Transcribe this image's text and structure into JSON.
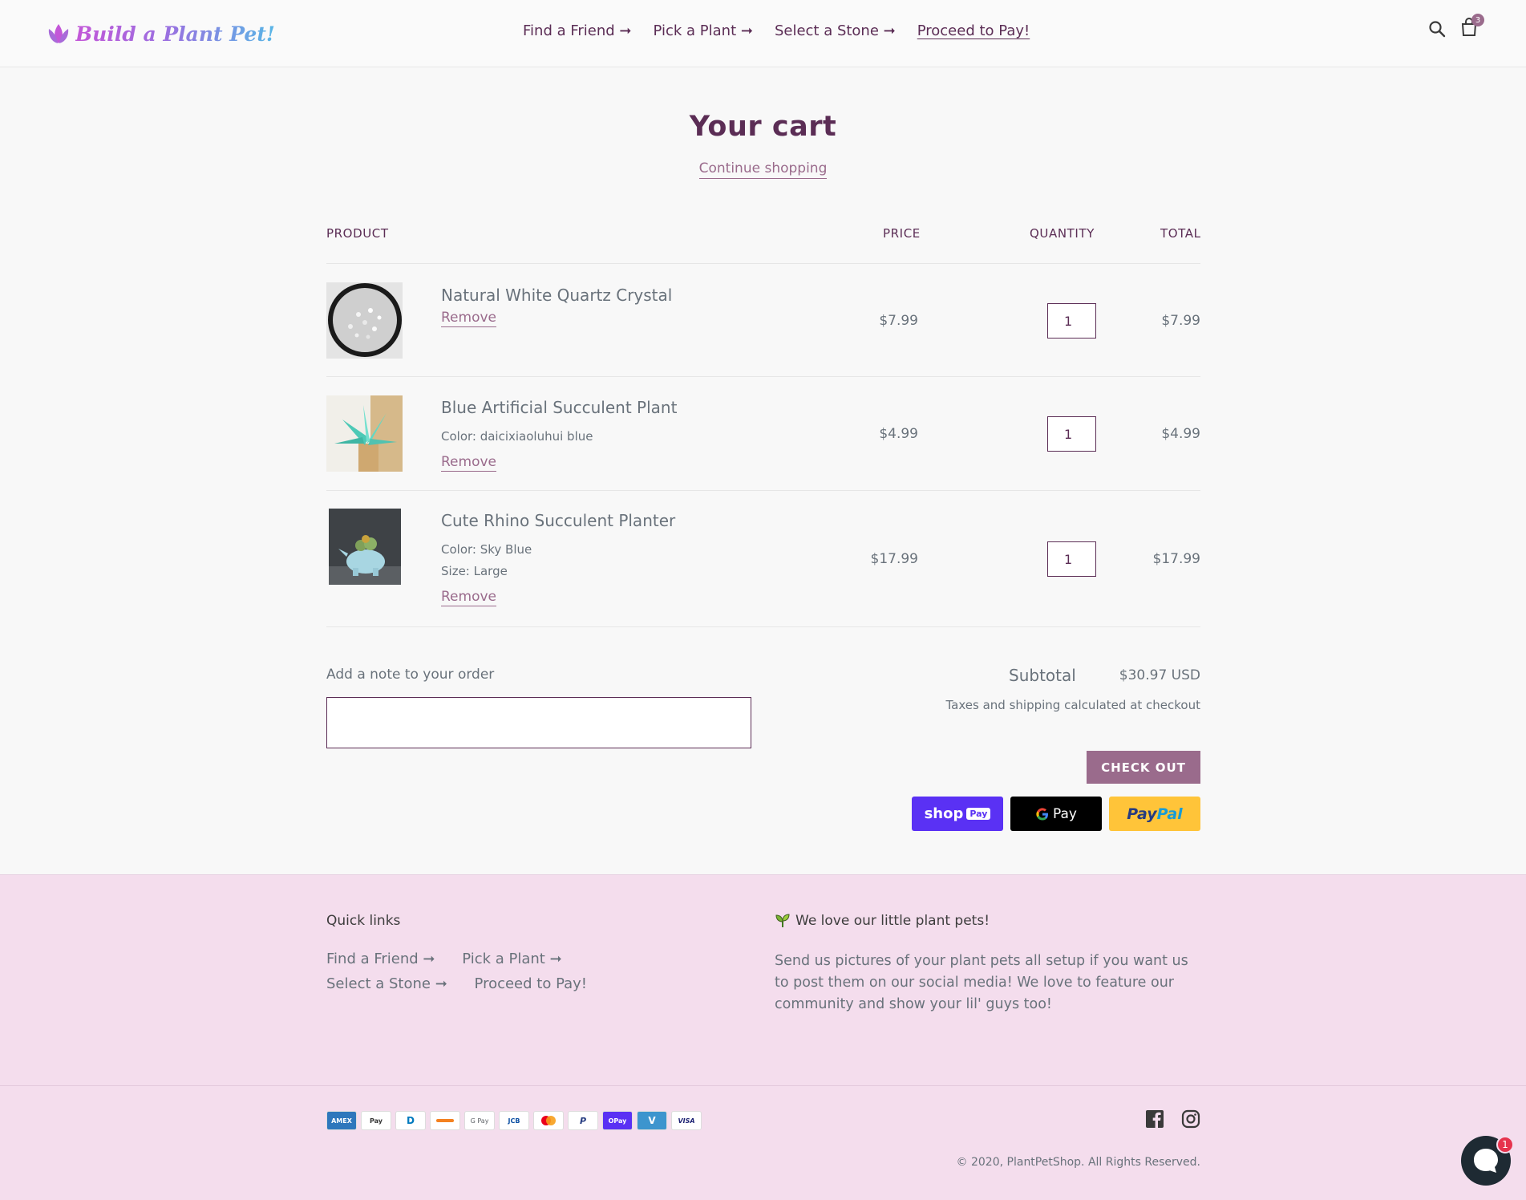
{
  "header": {
    "logo_text": "Build a Plant Pet!",
    "nav": [
      {
        "label": "Find a Friend ➞"
      },
      {
        "label": "Pick a Plant ➞"
      },
      {
        "label": "Select a Stone ➞"
      },
      {
        "label": "Proceed to Pay!"
      }
    ],
    "cart_count": "3",
    "search_icon": "search-icon",
    "cart_icon": "shopping-bag-icon"
  },
  "cart": {
    "title": "Your cart",
    "continue_label": "Continue shopping",
    "columns": {
      "product": "PRODUCT",
      "price": "PRICE",
      "quantity": "QUANTITY",
      "total": "TOTAL"
    },
    "items": [
      {
        "name": "Natural White Quartz Crystal",
        "options": [],
        "remove_label": "Remove",
        "price": "$7.99",
        "quantity": "1",
        "total": "$7.99"
      },
      {
        "name": "Blue Artificial Succulent Plant",
        "options": [
          "Color: daicixiaoluhui blue"
        ],
        "remove_label": "Remove",
        "price": "$4.99",
        "quantity": "1",
        "total": "$4.99"
      },
      {
        "name": "Cute Rhino Succulent Planter",
        "options": [
          "Color: Sky Blue",
          "Size: Large"
        ],
        "remove_label": "Remove",
        "price": "$17.99",
        "quantity": "1",
        "total": "$17.99"
      }
    ],
    "note_label": "Add a note to your order",
    "note_value": "",
    "subtotal_label": "Subtotal",
    "subtotal_value": "$30.97 USD",
    "tax_note": "Taxes and shipping calculated at checkout",
    "checkout_label": "CHECK OUT",
    "express": {
      "shop_pay": "shop",
      "shop_pay_pill": "Pay",
      "gpay": "Pay",
      "paypal_a": "Pay",
      "paypal_b": "Pal"
    }
  },
  "footer": {
    "quick_links_heading": "Quick links",
    "quick_links": [
      "Find a Friend ➞",
      "Pick a Plant ➞",
      "Select a Stone ➞",
      "Proceed to Pay!"
    ],
    "about_heading": "We love our little plant pets!",
    "about_text": "Send us pictures of your plant pets all setup if you want us to post them on our social media! We love to feature our community and show your lil' guys too!",
    "payment_icons": [
      "AMEX",
      "Pay",
      "D",
      "",
      "G Pay",
      "JCB",
      "",
      "P",
      "OPay",
      "V",
      "VISA"
    ],
    "copyright": "© 2020, PlantPetShop. All Rights Reserved.",
    "chat_badge": "1"
  },
  "colors": {
    "brand": "#5b2d55",
    "accent": "#9a6b8c",
    "footer_bg": "#f4dded"
  }
}
